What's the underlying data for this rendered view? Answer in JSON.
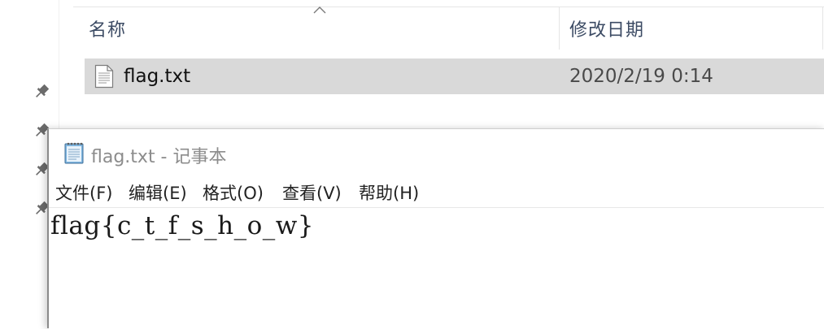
{
  "explorer": {
    "columns": {
      "name": "名称",
      "modified": "修改日期"
    },
    "files": [
      {
        "name": "flag.txt",
        "modified": "2020/2/19 0:14",
        "icon": "text-file-icon",
        "selected": true
      }
    ],
    "quick_access_pins": [
      "pin-icon",
      "pin-icon",
      "pin-icon",
      "pin-icon"
    ],
    "sort_indicator": "sort-up-icon"
  },
  "notepad": {
    "title": "flag.txt - 记事本",
    "app_icon": "notepad-icon",
    "menu": [
      "文件(F)",
      "编辑(E)",
      "格式(O)",
      "查看(V)",
      "帮助(H)"
    ],
    "content": "flag{c_t_f_s_h_o_w}"
  },
  "colors": {
    "selected_row_bg": "#d9d9d9",
    "header_text": "#3c4b64",
    "title_text_inactive": "#8c8c8c"
  }
}
